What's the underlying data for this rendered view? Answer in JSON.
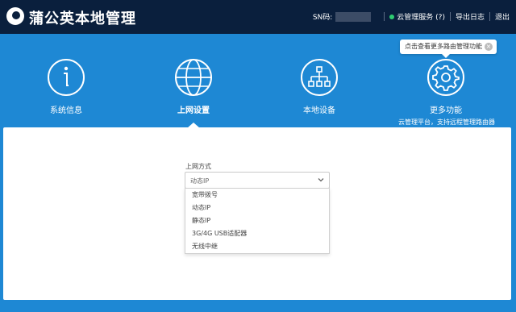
{
  "header": {
    "title": "蒲公英本地管理",
    "sn_label": "SN码:",
    "cloud_service": "云管理服务 (?)",
    "export_log": "导出日志",
    "logout": "退出"
  },
  "tooltip": {
    "text": "点击查看更多路由管理功能",
    "close": "×"
  },
  "nav": {
    "items": [
      {
        "label": "系统信息",
        "icon": "info-icon"
      },
      {
        "label": "上网设置",
        "icon": "globe-icon",
        "active": true
      },
      {
        "label": "本地设备",
        "icon": "network-icon"
      },
      {
        "label": "更多功能",
        "icon": "gear-icon",
        "subtitle": "云管理平台，支持远程管理路由器"
      }
    ]
  },
  "form": {
    "field_label": "上网方式",
    "selected": "动态IP",
    "options": [
      "宽带拨号",
      "动态IP",
      "静态IP",
      "3G/4G USB适配器",
      "无线中继"
    ]
  },
  "colors": {
    "topbar": "#0a1f3d",
    "background": "#1e88d4",
    "status_online": "#2ecc71"
  }
}
